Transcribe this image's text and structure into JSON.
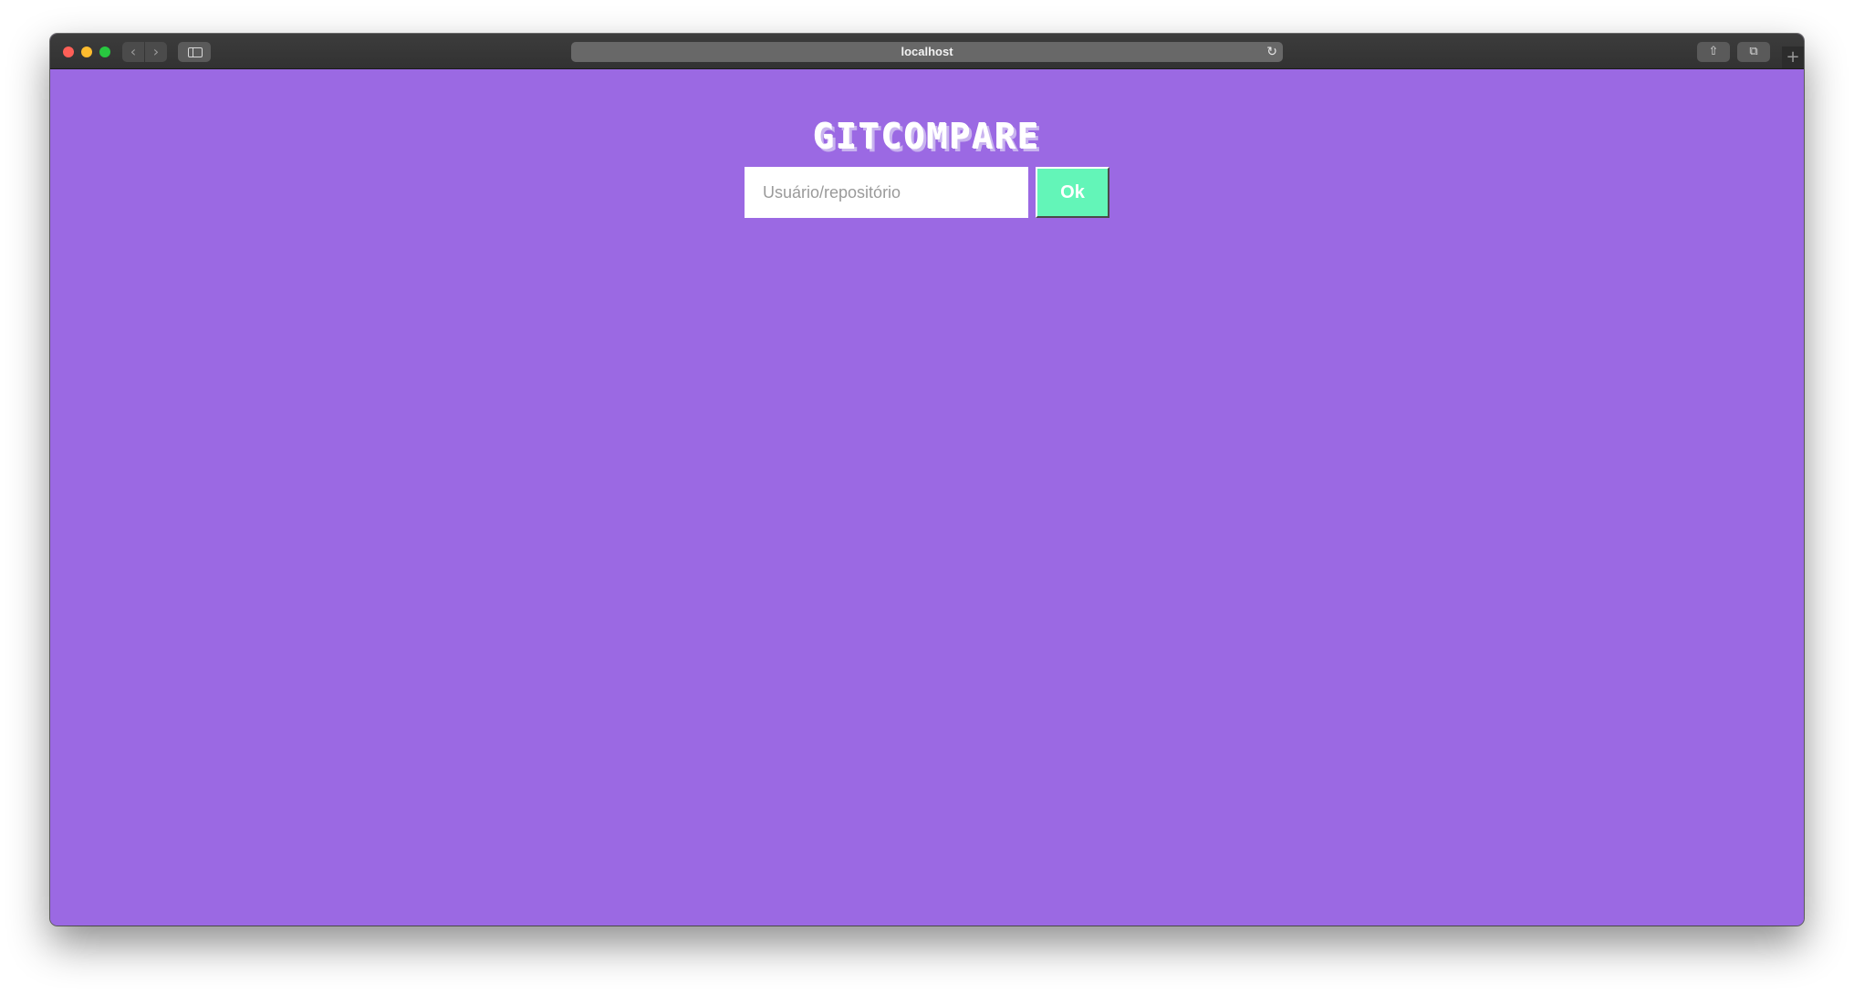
{
  "browser": {
    "url": "localhost",
    "back_icon": "chevron-left-icon",
    "forward_icon": "chevron-right-icon",
    "reload_icon": "reload-icon",
    "share_icon": "share-icon",
    "tabs_icon": "tabs-overview-icon",
    "new_tab_icon": "plus-icon"
  },
  "app": {
    "title": "GITCOMPARE",
    "search": {
      "placeholder": "Usuário/repositório",
      "value": ""
    },
    "submit_label": "Ok"
  },
  "colors": {
    "background": "#9b69e3",
    "button": "#63f5b8",
    "title": "#ffffff"
  }
}
